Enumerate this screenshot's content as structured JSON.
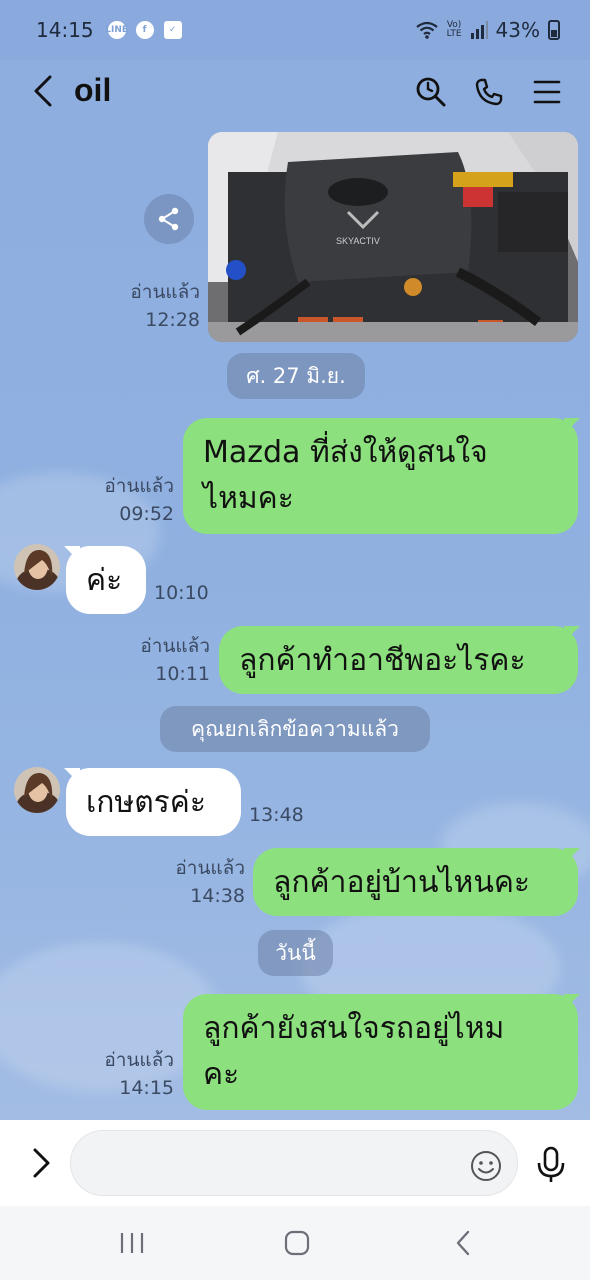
{
  "status_bar": {
    "time": "14:15",
    "notif_icons": [
      "line-icon",
      "facebook-icon",
      "check-box-icon"
    ],
    "network": "VoLTE",
    "network_top": "Vo)",
    "network_bottom": "LTE",
    "battery": "43%"
  },
  "header": {
    "title": "oil",
    "icons": [
      "back-icon",
      "search-icon",
      "phone-icon",
      "menu-icon"
    ]
  },
  "messages": [
    {
      "type": "image",
      "side": "out",
      "read": "อ่านแล้ว",
      "time": "12:28",
      "image": "engine-bay-photo"
    },
    {
      "type": "date",
      "text": "ศ. 27 มิ.ย."
    },
    {
      "type": "text",
      "side": "out",
      "text_line1": "Mazda ที่ส่งให้ดูสนใจ",
      "text_line2": "ไหมคะ",
      "read": "อ่านแล้ว",
      "time": "09:52"
    },
    {
      "type": "text",
      "side": "in",
      "text": "ค่ะ",
      "time": "10:10"
    },
    {
      "type": "text",
      "side": "out",
      "text": "ลูกค้าทำอาชีพอะไรคะ",
      "read": "อ่านแล้ว",
      "time": "10:11"
    },
    {
      "type": "system",
      "text": "คุณยกเลิกข้อความแล้ว"
    },
    {
      "type": "text",
      "side": "in",
      "text": "เกษตรค่ะ",
      "time": "13:48"
    },
    {
      "type": "text",
      "side": "out",
      "text": "ลูกค้าอยู่บ้านไหนคะ",
      "read": "อ่านแล้ว",
      "time": "14:38"
    },
    {
      "type": "date",
      "text": "วันนี้"
    },
    {
      "type": "text",
      "side": "out",
      "text_line1": "ลูกค้ายังสนใจรถอยู่ไหม",
      "text_line2": "คะ",
      "read": "อ่านแล้ว",
      "time": "14:15"
    }
  ],
  "input": {
    "value": "",
    "placeholder": ""
  },
  "colors": {
    "chat_bg": "#8eaedf",
    "outgoing_bubble": "#8de07e",
    "incoming_bubble": "#ffffff"
  }
}
